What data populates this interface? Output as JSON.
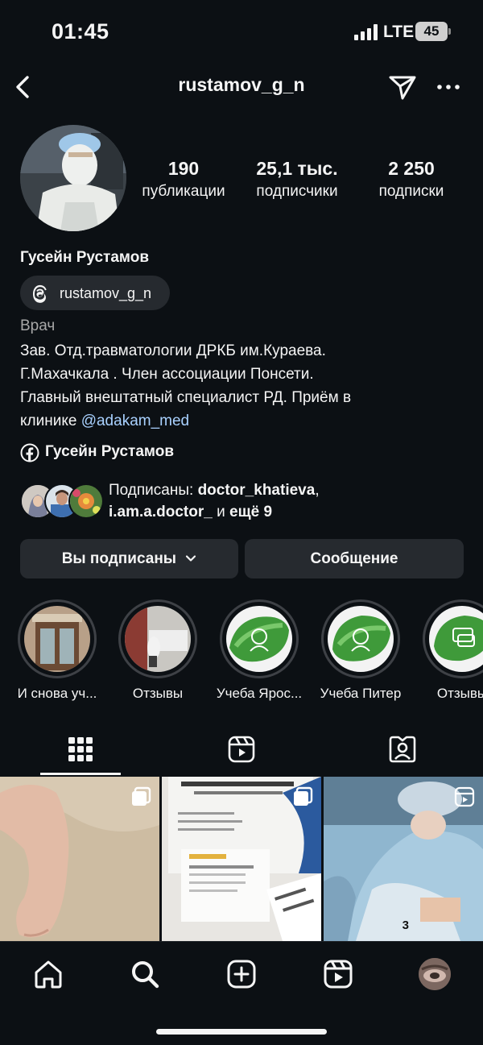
{
  "status_bar": {
    "time": "01:45",
    "network": "LTE",
    "battery": "45"
  },
  "header": {
    "username": "rustamov_g_n",
    "icons": [
      "back-icon",
      "send-icon",
      "more-icon"
    ]
  },
  "profile": {
    "stats": [
      {
        "value": "190",
        "label": "публикации"
      },
      {
        "value": "25,1 тыс.",
        "label": "подписчики"
      },
      {
        "value": "2 250",
        "label": "подписки"
      }
    ],
    "full_name": "Гусейн Рустамов",
    "threads_handle": "rustamov_g_n",
    "category": "Врач",
    "bio": {
      "line1": "Зав. Отд.травматологии ДРКБ им.Кураева.",
      "line2": "Г.Махачкала . Член ассоциации Понсети.",
      "line3": "Главный внештатный специалист РД.  Приём в",
      "line4_prefix": "клинике ",
      "mention": "@adakam_med"
    },
    "facebook_name": "Гусейн Рустамов",
    "followed_by": {
      "prefix": "Подписаны: ",
      "user1": "doctor_khatieva",
      "sep": ",",
      "user2": "i.am.a.doctor_",
      "suffix_and": " и ",
      "more": "ещё 9"
    }
  },
  "actions": {
    "following_label": "Вы подписаны",
    "message_label": "Сообщение"
  },
  "highlights": [
    {
      "label": "И снова уч..."
    },
    {
      "label": "Отзывы"
    },
    {
      "label": "Учеба Ярос..."
    },
    {
      "label": "Учеба Питер"
    },
    {
      "label": "Отзывы"
    }
  ],
  "tabs": [
    "grid-icon",
    "reels-icon",
    "tagged-icon"
  ],
  "grid": {
    "post3_count": "3"
  },
  "bottom_nav": [
    "home-icon",
    "search-icon",
    "create-icon",
    "reels-icon",
    "profile-avatar"
  ],
  "colors": {
    "background": "#0c1014",
    "button": "#262a2f",
    "mention": "#a9d1ff",
    "secondary_text": "#a8a8a8"
  }
}
